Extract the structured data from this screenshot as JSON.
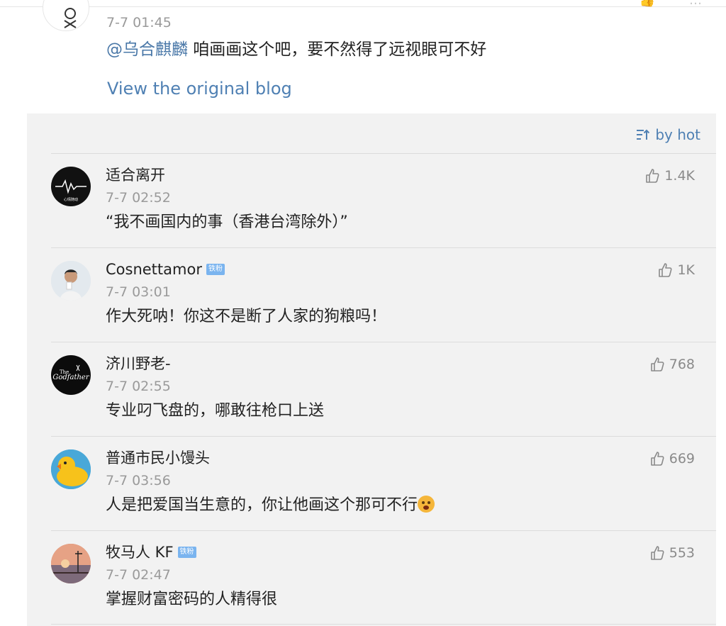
{
  "post": {
    "time": "7-7 01:45",
    "mention": "@乌合麒麟",
    "text": " 咱画画这个吧，要不然得了远视眼可不好",
    "view_original": "View the original blog"
  },
  "comments_panel": {
    "sort_label": "by hot",
    "accent_color": "#4f80b3",
    "comments": [
      {
        "name": "适合离开",
        "badge": "",
        "time": "7-7 02:52",
        "text": "“我不画国内的事（香港台湾除外）”",
        "likes": "1.4K",
        "avatar_icon": "sickle-heartbeat-avatar"
      },
      {
        "name": "Cosnettamor",
        "badge": "铁粉",
        "time": "7-7 03:01",
        "text": "作大死呐！你这不是断了人家的狗粮吗！",
        "likes": "1K",
        "avatar_icon": "person-photo-avatar"
      },
      {
        "name": "济川野老-",
        "badge": "",
        "time": "7-7 02:55",
        "text": "专业叼飞盘的，哪敢往枪口上送",
        "likes": "768",
        "avatar_icon": "godfather-avatar"
      },
      {
        "name": "普通市民小馒头",
        "badge": "",
        "time": "7-7 03:56",
        "text": "人是把爱国当生意的，你让他画这个那可不行",
        "likes": "669",
        "avatar_icon": "rubber-duck-avatar"
      },
      {
        "name": "牧马人 KF",
        "badge": "铁粉",
        "time": "7-7 02:47",
        "text": "掌握财富密码的人精得很",
        "likes": "553",
        "avatar_icon": "sunset-avatar"
      }
    ]
  }
}
